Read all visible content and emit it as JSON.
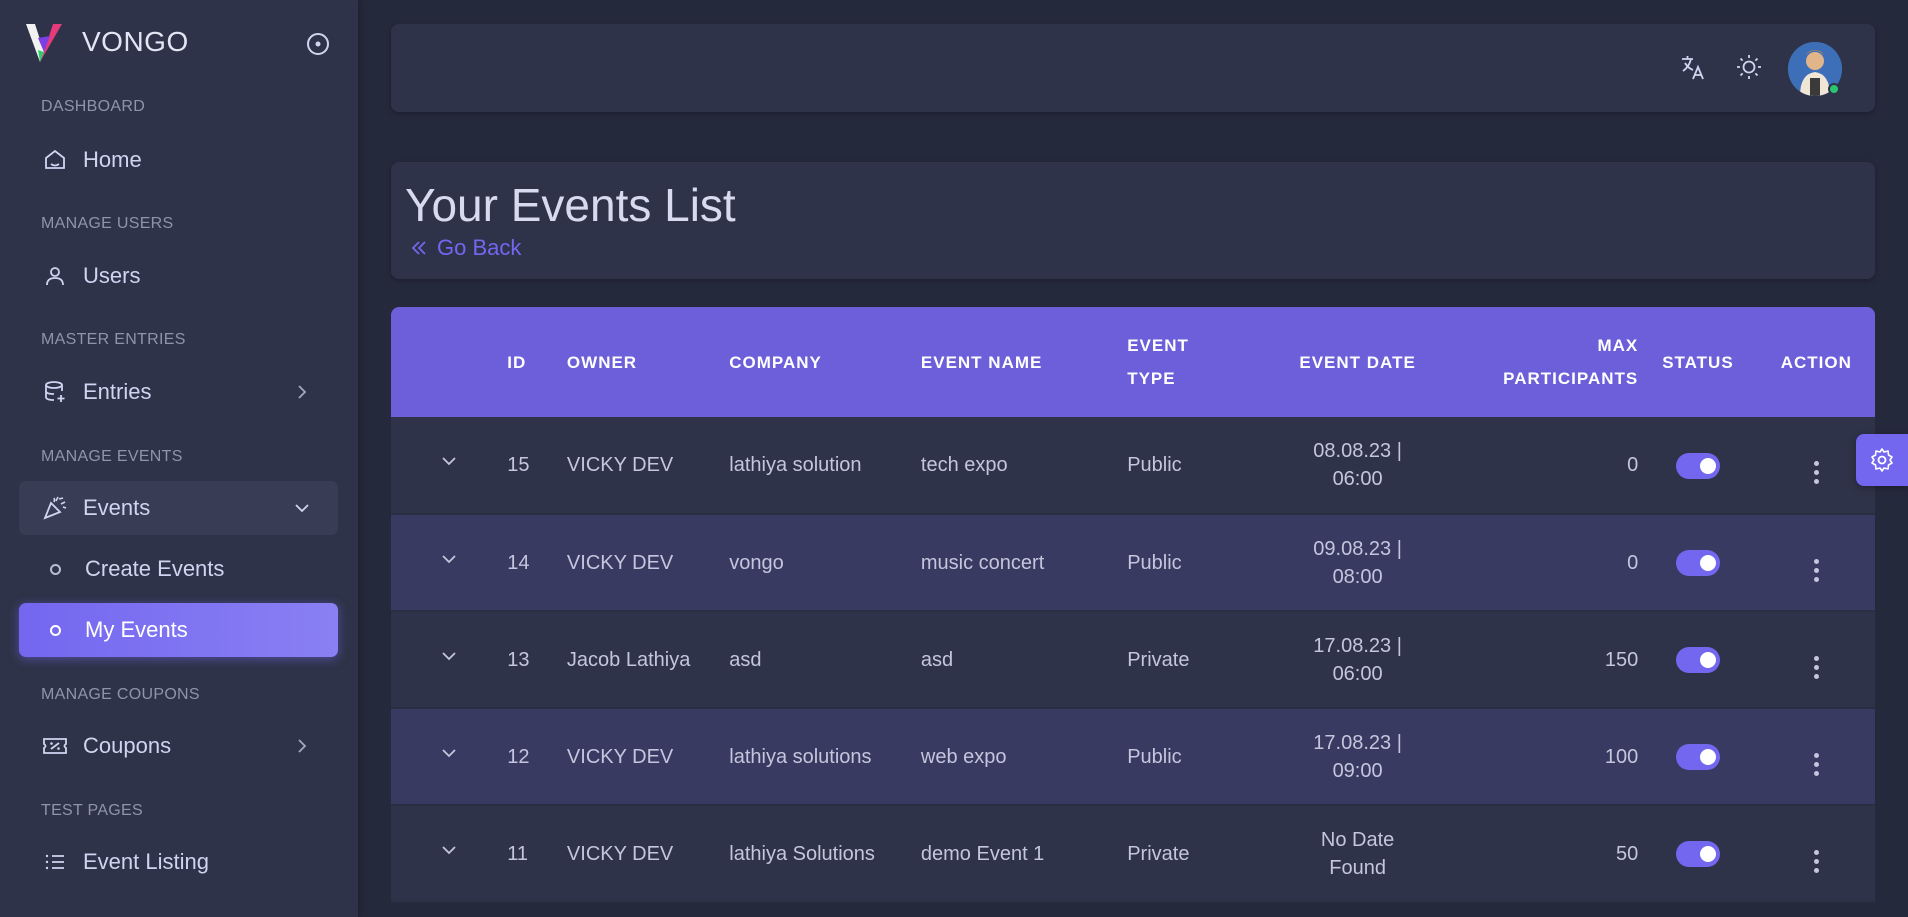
{
  "brand": {
    "name": "VONGO"
  },
  "sidebar": {
    "sections": [
      {
        "header": "DASHBOARD"
      },
      {
        "header": "MANAGE USERS"
      },
      {
        "header": "MASTER ENTRIES"
      },
      {
        "header": "MANAGE EVENTS"
      },
      {
        "header": "MANAGE COUPONS"
      },
      {
        "header": "TEST PAGES"
      }
    ],
    "items": {
      "home": "Home",
      "users": "Users",
      "entries": "Entries",
      "events": "Events",
      "create_events": "Create Events",
      "my_events": "My Events",
      "coupons": "Coupons",
      "event_listing": "Event Listing"
    }
  },
  "page": {
    "title": "Your Events List",
    "go_back": "Go Back"
  },
  "table": {
    "headers": {
      "id": "ID",
      "owner": "OWNER",
      "company": "COMPANY",
      "event_name": "EVENT NAME",
      "event_type_1": "EVENT",
      "event_type_2": "TYPE",
      "event_date": "EVENT DATE",
      "max_1": "MAX",
      "max_2": "PARTICIPANTS",
      "status": "STATUS",
      "action": "ACTION"
    },
    "rows": [
      {
        "id": "15",
        "owner": "VICKY DEV",
        "company": "lathiya solution",
        "event_name": "tech expo",
        "event_type": "Public",
        "date_1": "08.08.23 |",
        "date_2": "06:00",
        "max": "0",
        "status": true
      },
      {
        "id": "14",
        "owner": "VICKY DEV",
        "company": "vongo",
        "event_name": "music concert",
        "event_type": "Public",
        "date_1": "09.08.23 |",
        "date_2": "08:00",
        "max": "0",
        "status": true
      },
      {
        "id": "13",
        "owner": "Jacob Lathiya",
        "company": "asd",
        "event_name": "asd",
        "event_type": "Private",
        "date_1": "17.08.23 |",
        "date_2": "06:00",
        "max": "150",
        "status": true
      },
      {
        "id": "12",
        "owner": "VICKY DEV",
        "company": "lathiya solutions",
        "event_name": "web expo",
        "event_type": "Public",
        "date_1": "17.08.23 |",
        "date_2": "09:00",
        "max": "100",
        "status": true
      },
      {
        "id": "11",
        "owner": "VICKY DEV",
        "company": "lathiya Solutions",
        "event_name": "demo Event 1",
        "event_type": "Private",
        "date_1": "No Date",
        "date_2": "Found",
        "max": "50",
        "status": true
      }
    ]
  },
  "colors": {
    "accent": "#7367f0",
    "table_header": "#6c5fd9",
    "sidebar_bg": "#2f3349",
    "page_bg": "#25293c",
    "status_online": "#28c76f"
  },
  "icons": {
    "sidebar_toggle": "circle-dot-icon",
    "home": "home-icon",
    "users": "user-icon",
    "entries": "database-plus-icon",
    "events": "confetti-icon",
    "coupons": "coupon-icon",
    "event_listing": "list-icon",
    "translate": "translate-icon",
    "theme": "sun-icon",
    "settings": "gear-icon"
  }
}
